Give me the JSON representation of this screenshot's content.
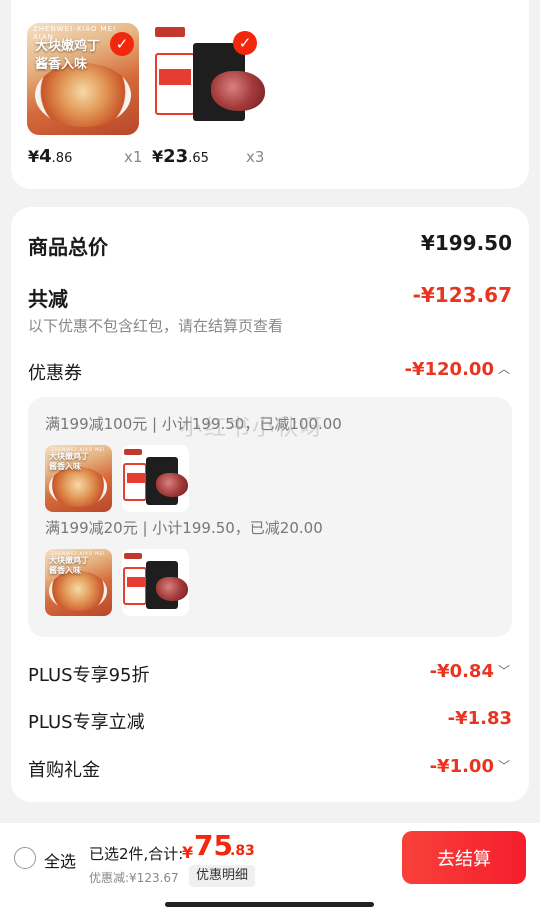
{
  "top_items": [
    {
      "name": "chicken",
      "caption_line1": "大块嫩鸡丁",
      "caption_line2": "酱香入味",
      "caption_tiny": "ZHENWEI·XIAO MEI XIAN",
      "price_yen": "¥",
      "price_int": "4",
      "price_dec": ".86",
      "qty": "x1"
    },
    {
      "name": "beef",
      "price_yen": "¥",
      "price_int": "23",
      "price_dec": ".65",
      "qty": "x3"
    }
  ],
  "summary": {
    "total_label": "商品总价",
    "total_value": "¥199.50",
    "reduce_label": "共减",
    "reduce_value": "-¥123.67",
    "note": "以下优惠不包含红包，请在结算页查看",
    "coupon_label": "优惠券",
    "coupon_value": "-¥120.00",
    "coupon_groups": [
      {
        "line": "满199减100元 | 小计199.50，已减100.00"
      },
      {
        "line": "满199减20元 | 小计199.50，已减20.00"
      }
    ],
    "plus95_label": "PLUS专享95折",
    "plus95_value": "-¥0.84",
    "plus_reduce_label": "PLUS专享立减",
    "plus_reduce_value": "-¥1.83",
    "first_gift_label": "首购礼金",
    "first_gift_value": "-¥1.00"
  },
  "watermark": "小红书小秋呀",
  "bottom_bar": {
    "select_all": "全选",
    "summary_text": "已选2件,合计:",
    "total_yen": "¥",
    "total_int": "75",
    "total_dec": ".83",
    "discount_text": "优惠减:¥123.67",
    "detail_button": "优惠明细",
    "checkout_button": "去结算"
  },
  "colors": {
    "accent": "#f2270c",
    "background": "#f2f2f2"
  }
}
